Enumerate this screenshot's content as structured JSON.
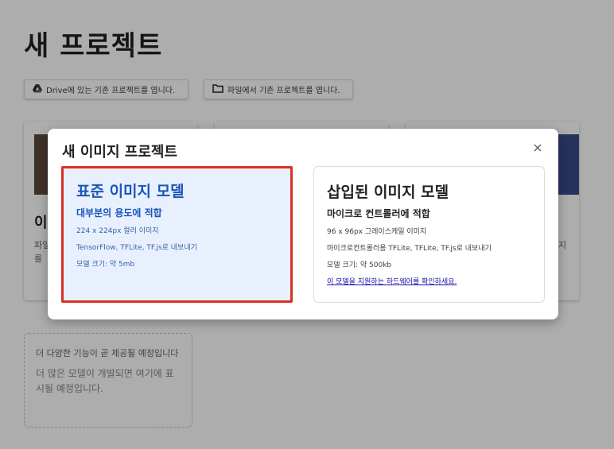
{
  "page": {
    "title": "새 프로젝트",
    "open_drive_label": "Drive에 있는 기존 프로젝트를 엽니다.",
    "open_file_label": "파일에서 기존 프로젝트를 엽니다."
  },
  "background_cards": {
    "card1_title": "이",
    "card1_desc_line1": "파일",
    "card1_desc_line2": "를",
    "card3_desc_fragment": "지"
  },
  "coming_soon": {
    "title": "더 다양한 기능이 곧 제공될 예정입니다",
    "description": "더 많은 모델이 개발되면 여기에 표시될 예정입니다."
  },
  "dialog": {
    "title": "새 이미지 프로젝트",
    "close_icon": "close-icon",
    "options": [
      {
        "title": "표준 이미지 모델",
        "subtitle": "대부분의 용도에 적합",
        "details": [
          "224 x 224px 컬러 이미지",
          "TensorFlow, TFLite, TF.js로 내보내기",
          "모델 크기: 약 5mb"
        ]
      },
      {
        "title": "삽입된 이미지 모델",
        "subtitle": "마이크로 컨트롤러에 적합",
        "details": [
          "96 x 96px 그레이스케일 이미지",
          "마이크로컨트롤러용 TFLite, TFLite, TF.js로 내보내기",
          "모델 크기: 약 500kb"
        ],
        "link": "이 모델을 지원하는 하드웨어를 확인하세요."
      }
    ]
  },
  "colors": {
    "selected_border": "#d93025",
    "selected_bg": "#e8f0fe",
    "accent_blue": "#1a56b7",
    "scrim": "rgba(0,0,0,0.32)"
  }
}
